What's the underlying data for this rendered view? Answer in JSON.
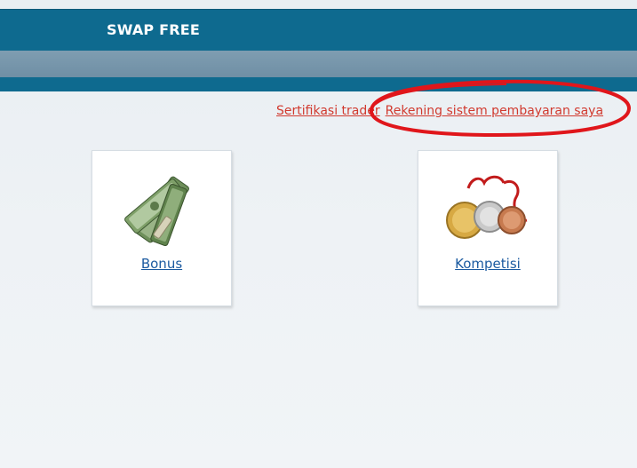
{
  "header": {
    "title": "SWAP FREE"
  },
  "links": {
    "certification": "Sertifikasi trader",
    "payment_accounts": "Rekening sistem pembayaran saya"
  },
  "tiles": [
    {
      "label": "Bonus",
      "icon": "money-icon"
    },
    {
      "label": "Kompetisi",
      "icon": "medals-icon"
    }
  ],
  "colors": {
    "header_bg": "#0e6a8f",
    "midbar_bg": "#7f9db1",
    "link_red": "#d13a2f",
    "tile_link_blue": "#1b5aa0",
    "annotation_red": "#e0161b"
  }
}
